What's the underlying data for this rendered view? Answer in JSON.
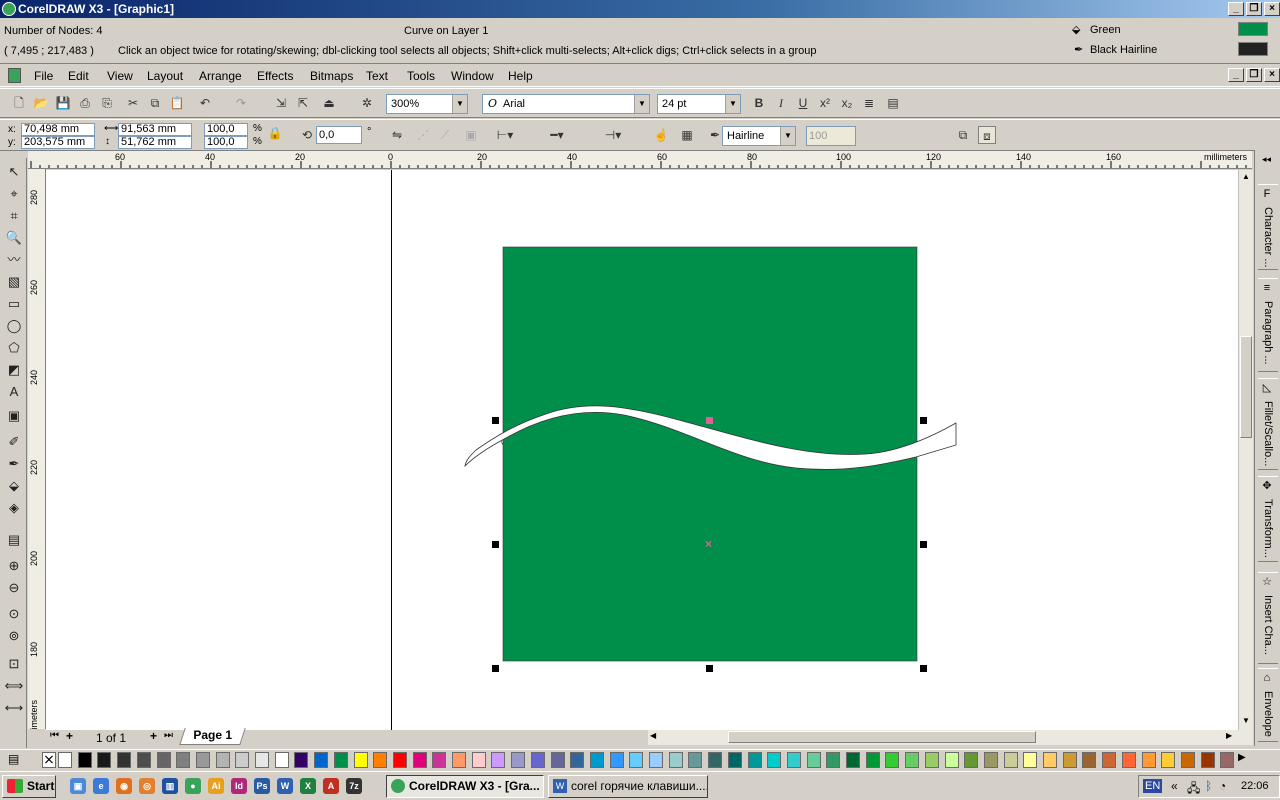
{
  "window": {
    "title": "CorelDRAW X3 - [Graphic1]"
  },
  "status": {
    "nodes": "Number of Nodes: 4",
    "object": "Curve on Layer 1",
    "coords": "( 7,495 ; 217,483 )",
    "hint": "Click an object twice for rotating/skewing; dbl-clicking tool selects all objects; Shift+click multi-selects; Alt+click digs; Ctrl+click selects in a group",
    "fill_name": "Green",
    "outline_name": "Black  Hairline",
    "fill_color": "#008f4a",
    "outline_color": "#222222"
  },
  "menu": [
    "File",
    "Edit",
    "View",
    "Layout",
    "Arrange",
    "Effects",
    "Bitmaps",
    "Text",
    "Tools",
    "Window",
    "Help"
  ],
  "standard_toolbar": {
    "zoom": "300%",
    "font_name": "Arial",
    "font_size": "24 pt",
    "bold": "B",
    "italic": "I",
    "underline": "U"
  },
  "property_bar": {
    "x": "70,498 mm",
    "y": "203,575 mm",
    "width": "91,563 mm",
    "height": "51,762 mm",
    "scale_x": "100,0",
    "scale_y": "100,0",
    "percent": "%",
    "rotation": "0,0",
    "degree": "°",
    "outline_width": "Hairline",
    "curve_smoothness": "100",
    "x_label": "x:",
    "y_label": "y:"
  },
  "rulers": {
    "h_labels": [
      "60",
      "40",
      "20",
      "0",
      "20",
      "40",
      "60",
      "80",
      "100",
      "120",
      "140",
      "160"
    ],
    "v_labels": [
      "280",
      "260",
      "240",
      "220",
      "200",
      "180"
    ],
    "units": "millimeters"
  },
  "docker_tabs": [
    "Character ...",
    "Paragraph ...",
    "Fillet/Scallo...",
    "Transform...",
    "Insert Cha...",
    "Envelope"
  ],
  "page_nav": {
    "count": "1 of 1",
    "page": "Page 1"
  },
  "palette": [
    "#ffffff",
    "#000000",
    "#1a1a1a",
    "#333333",
    "#4d4d4d",
    "#666666",
    "#808080",
    "#999999",
    "#b3b3b3",
    "#cccccc",
    "#e6e6e6",
    "#ffffff",
    "#330066",
    "#0066cc",
    "#008f4a",
    "#ffff00",
    "#ff8000",
    "#ff0000",
    "#e0007a",
    "#cc3399",
    "#ff9966",
    "#ffcccc",
    "#cc99ff",
    "#9999cc",
    "#6666cc",
    "#666699",
    "#336699",
    "#0099cc",
    "#3399ff",
    "#66ccff",
    "#99ccff",
    "#99cccc",
    "#669999",
    "#336666",
    "#006666",
    "#009999",
    "#00cccc",
    "#33cccc",
    "#66cc99",
    "#339966",
    "#006633",
    "#009933",
    "#33cc33",
    "#66cc66",
    "#99cc66",
    "#ccff99",
    "#669933",
    "#999966",
    "#cccc99",
    "#ffff99",
    "#ffcc66",
    "#cc9933",
    "#996633",
    "#cc6633",
    "#ff6633",
    "#ff9933",
    "#ffcc33",
    "#cc6600",
    "#993300",
    "#996666"
  ],
  "taskbar": {
    "start": "Start",
    "tasks": [
      "CorelDRAW X3 - [Gra...",
      "corel горячие клавиши...."
    ],
    "lang": "EN",
    "time": "22:06"
  }
}
